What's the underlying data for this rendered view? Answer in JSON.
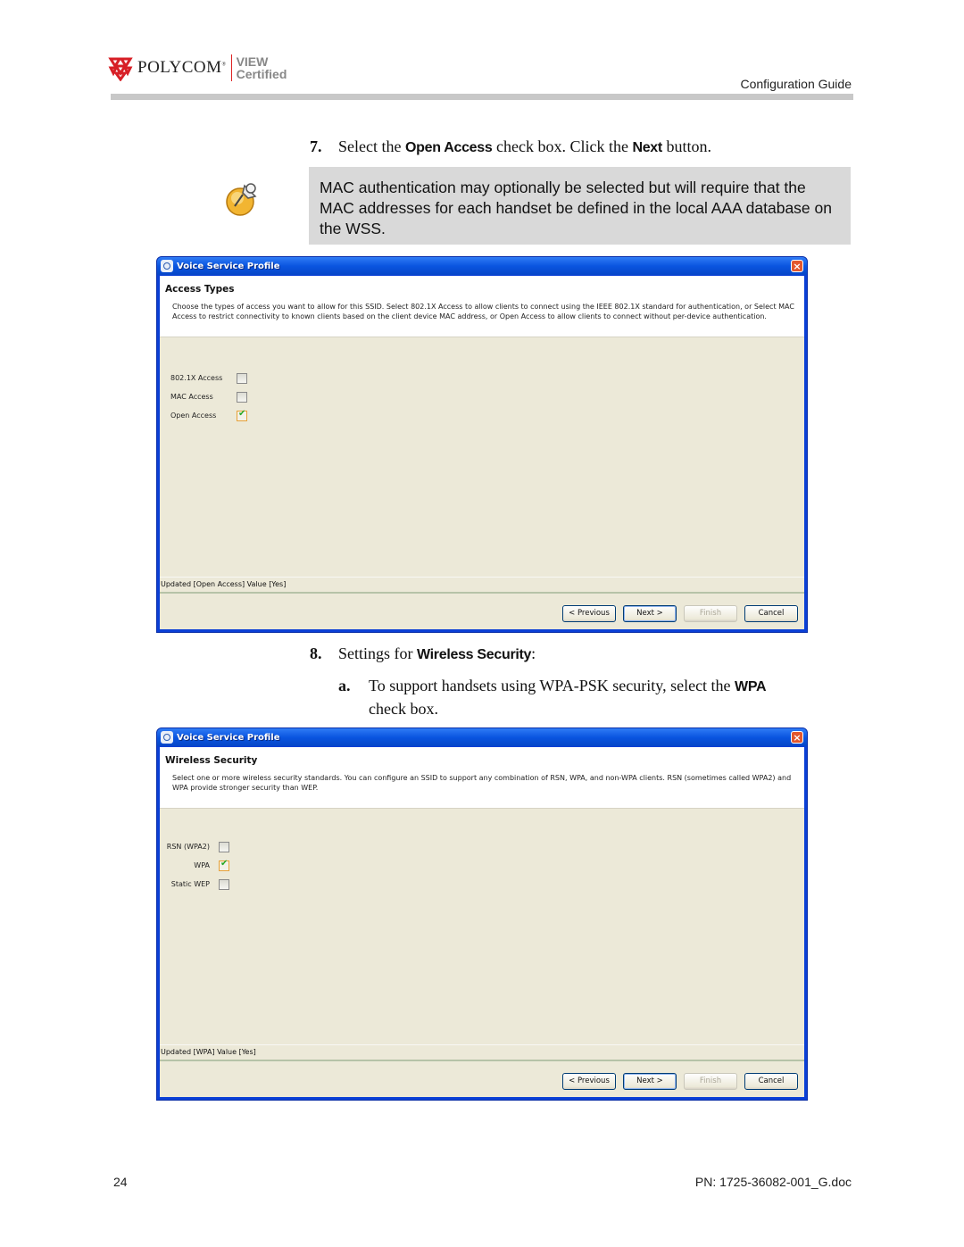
{
  "header": {
    "brand": "POLYCOM",
    "trademark": "®",
    "badge_line1": "VIEW",
    "badge_line2": "Certified",
    "guide_title": "Configuration Guide",
    "logo_color": "#d71f26"
  },
  "step7": {
    "number": "7.",
    "text_before": "Select the ",
    "keyword1": "Open Access",
    "text_middle": " check box. Click the ",
    "keyword2": "Next",
    "text_after": " button."
  },
  "note": {
    "icon": "pushpin-note-icon",
    "text": "MAC authentication may optionally be selected but will require that the MAC addresses for each handset be defined in the local AAA database on the WSS."
  },
  "dialog1": {
    "window_title": "Voice Service Profile",
    "panel_title": "Access Types",
    "description": "Choose the types of access you want to allow for this SSID. Select 802.1X Access to allow clients to connect using the IEEE 802.1X standard for authentication, or Select MAC Access to restrict connectivity to known clients based on the client device MAC address, or Open Access to allow clients to connect without per-device authentication.",
    "options": [
      {
        "label": "802.1X Access",
        "checked": false
      },
      {
        "label": "MAC Access",
        "checked": false
      },
      {
        "label": "Open Access",
        "checked": true
      }
    ],
    "status": "Updated [Open Access] Value [Yes]",
    "buttons": {
      "previous": "< Previous",
      "next": "Next >",
      "finish": "Finish",
      "cancel": "Cancel"
    }
  },
  "step8": {
    "number": "8.",
    "text_before": "Settings for ",
    "keyword": "Wireless Security",
    "text_after": ":"
  },
  "step8a": {
    "letter": "a.",
    "text_before": "To support handsets using WPA-PSK security, select the ",
    "keyword": "WPA",
    "text_after": "check box."
  },
  "dialog2": {
    "window_title": "Voice Service Profile",
    "panel_title": "Wireless Security",
    "description": "Select one or more wireless security standards. You can configure an SSID to support any combination of RSN, WPA, and non-WPA clients. RSN (sometimes called WPA2) and WPA provide stronger security than WEP.",
    "options": [
      {
        "label": "RSN (WPA2)",
        "checked": false
      },
      {
        "label": "WPA",
        "checked": true
      },
      {
        "label": "Static WEP",
        "checked": false
      }
    ],
    "status": "Updated [WPA] Value [Yes]",
    "buttons": {
      "previous": "< Previous",
      "next": "Next >",
      "finish": "Finish",
      "cancel": "Cancel"
    }
  },
  "footer": {
    "page_number": "24",
    "part_number": "PN: 1725-36082-001_G.doc"
  }
}
